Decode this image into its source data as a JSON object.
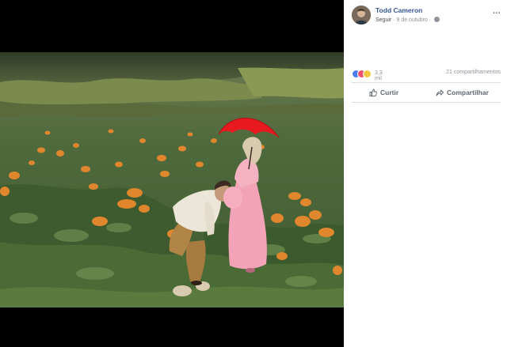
{
  "post": {
    "author": "Todd Cameron",
    "follow_label": "Seguir",
    "separator": "·",
    "date": "9 de outubro",
    "privacy_icon": "globe-icon",
    "more_icon": "more-options-icon",
    "more_glyph": "..."
  },
  "stats": {
    "reaction_icons": [
      "like-reaction-icon",
      "love-reaction-icon",
      "haha-reaction-icon"
    ],
    "reaction_count": "3,3 mil",
    "shares": "21 compartilhamentos"
  },
  "actions": {
    "like_label": "Curtir",
    "share_label": "Compartilhar"
  },
  "colors": {
    "link": "#385898",
    "muted": "#90949c",
    "divider": "#dadde1",
    "umbrella": "#e8191f",
    "dress": "#f2a3b8"
  }
}
